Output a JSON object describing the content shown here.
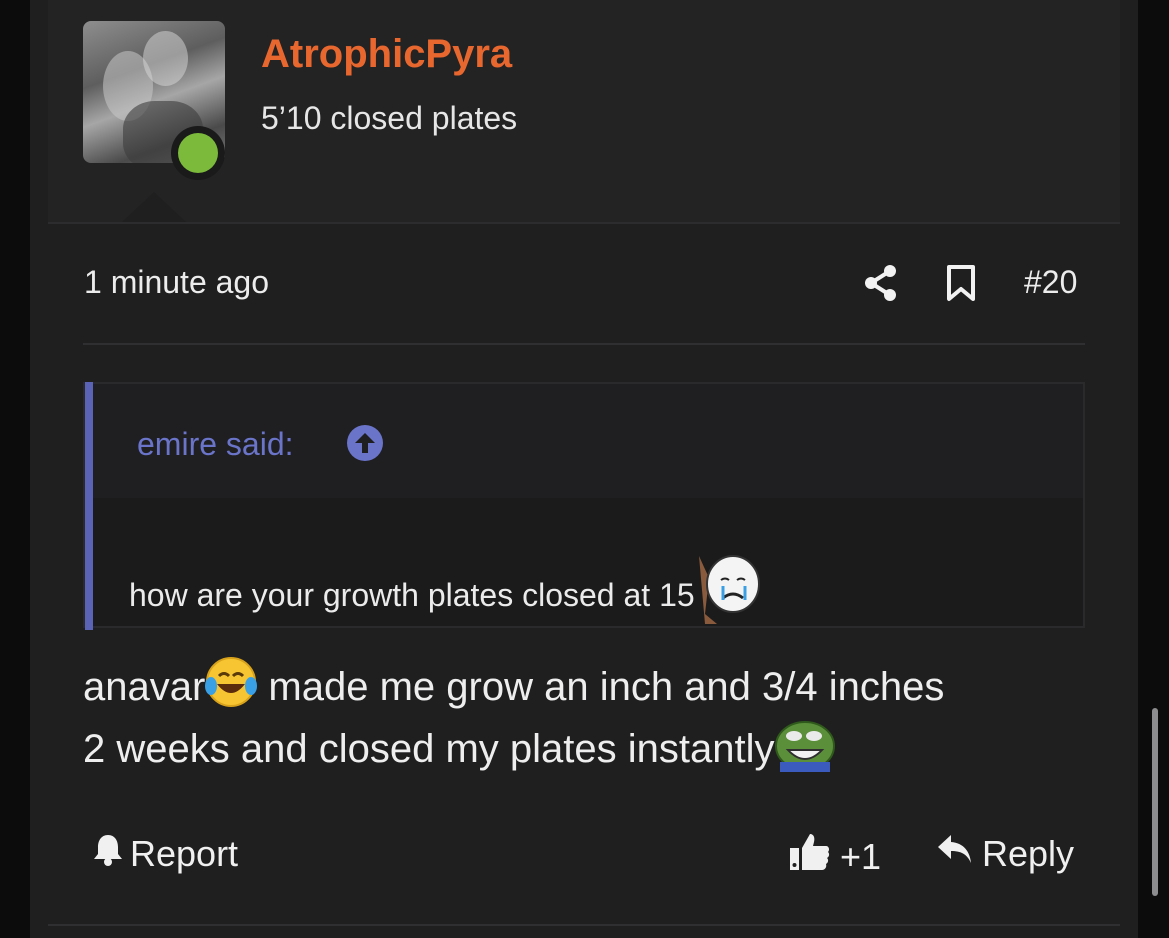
{
  "user": {
    "name": "AtrophicPyra",
    "title": "5’10 closed plates",
    "online_color": "#7cba3b",
    "name_color": "#e8672f"
  },
  "post": {
    "time": "1 minute ago",
    "number": "#20",
    "icons": [
      "share-icon",
      "bookmark-icon"
    ]
  },
  "quote": {
    "author": "emire said:",
    "text": "how are your growth plates closed at 15",
    "accent_color": "#5b63b7"
  },
  "body": {
    "part1": "anavar",
    "part2": " made me grow an inch and 3/4 inches",
    "part3": "2 weeks and closed my plates instantly"
  },
  "actions": {
    "report": "Report",
    "likes": "+1",
    "reply": "Reply"
  }
}
